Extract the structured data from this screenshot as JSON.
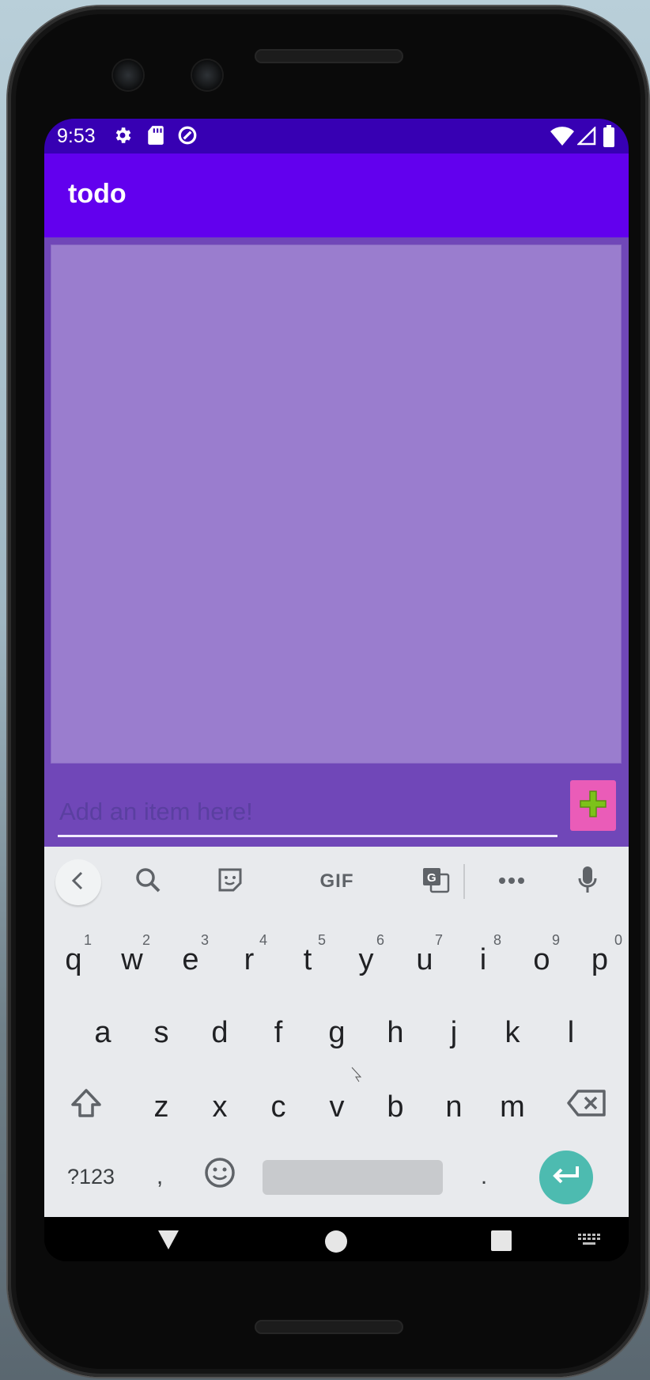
{
  "status_bar": {
    "time": "9:53"
  },
  "app_bar": {
    "title": "todo"
  },
  "main": {
    "input_placeholder": "Add an item here!",
    "input_value": ""
  },
  "keyboard": {
    "toolbar": {
      "gif_label": "GIF"
    },
    "row1": [
      "q",
      "w",
      "e",
      "r",
      "t",
      "y",
      "u",
      "i",
      "o",
      "p"
    ],
    "row1_hints": [
      "1",
      "2",
      "3",
      "4",
      "5",
      "6",
      "7",
      "8",
      "9",
      "0"
    ],
    "row2": [
      "a",
      "s",
      "d",
      "f",
      "g",
      "h",
      "j",
      "k",
      "l"
    ],
    "row3": [
      "z",
      "x",
      "c",
      "v",
      "b",
      "n",
      "m"
    ],
    "symbols_label": "?123",
    "comma": ",",
    "period": "."
  },
  "colors": {
    "status_bar": "#3700b3",
    "app_bar": "#6200ee",
    "content_bg": "#7047b8",
    "list_bg": "#9a7dce",
    "add_button": "#ea5cb8",
    "add_icon": "#7cc21a",
    "enter_key": "#4dbbb0"
  },
  "icons": [
    "settings-icon",
    "sd-card-icon",
    "data-saver-icon",
    "wifi-icon",
    "signal-icon",
    "battery-icon",
    "plus-icon",
    "back-chevron-icon",
    "search-icon",
    "sticker-icon",
    "translate-icon",
    "more-icon",
    "mic-icon",
    "shift-icon",
    "backspace-icon",
    "emoji-icon",
    "enter-icon",
    "nav-back-icon",
    "nav-home-icon",
    "nav-recents-icon",
    "keyboard-switch-icon"
  ]
}
